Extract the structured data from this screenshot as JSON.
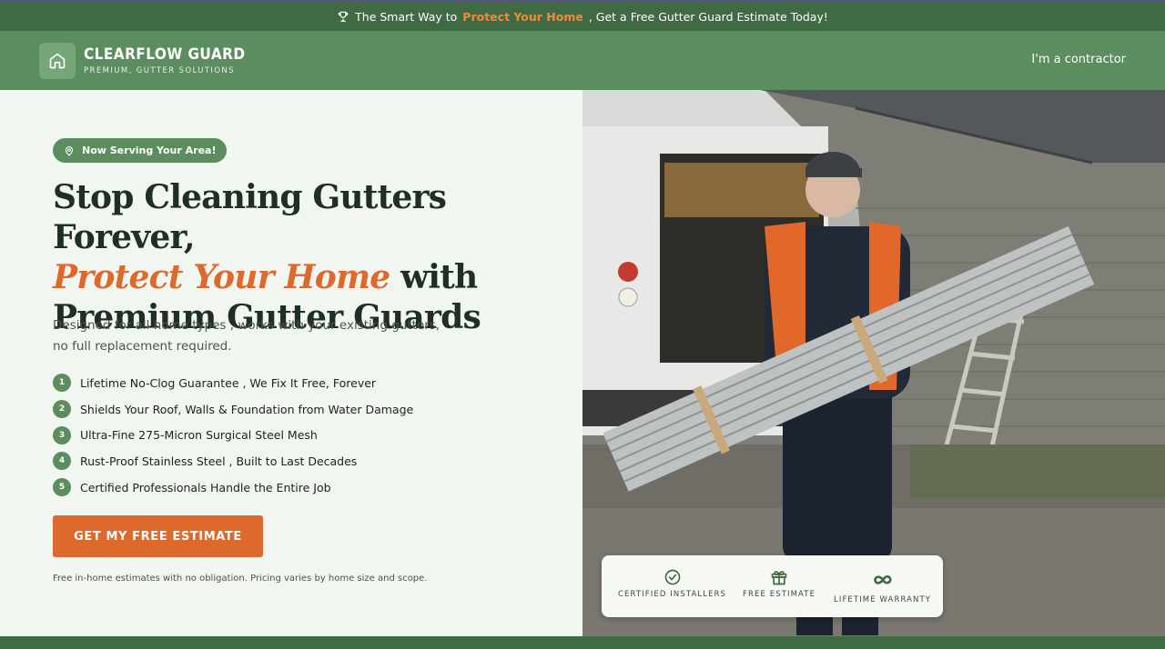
{
  "announcement": {
    "prefix": "The Smart Way to",
    "highlight": "Protect Your Home",
    "suffix": ", Get a Free Gutter Guard Estimate Today!"
  },
  "header": {
    "brand_name": "CLEARFLOW GUARD",
    "brand_tagline": "PREMIUM, GUTTER SOLUTIONS",
    "contractor_link": "I'm a contractor"
  },
  "hero": {
    "badge": "Now Serving Your Area!",
    "headline_line1": "Stop Cleaning Gutters Forever,",
    "headline_accent": "Protect Your Home",
    "headline_line2_rest": " with",
    "headline_line3": "Premium Gutter Guards",
    "subheadline": "Designed for all home types , works with your existing gutters, no full replacement required.",
    "features": [
      {
        "num": "1",
        "text": "Lifetime No-Clog Guarantee , We Fix It Free, Forever"
      },
      {
        "num": "2",
        "text": "Shields Your Roof, Walls & Foundation from Water Damage"
      },
      {
        "num": "3",
        "text": "Ultra-Fine 275-Micron Surgical Steel Mesh"
      },
      {
        "num": "4",
        "text": "Rust-Proof Stainless Steel , Built to Last Decades"
      },
      {
        "num": "5",
        "text": "Certified Professionals Handle the Entire Job"
      }
    ],
    "cta_label": "GET MY FREE ESTIMATE",
    "disclaimer": "Free in-home estimates with no obligation. Pricing varies by home size and scope."
  },
  "trust": {
    "certified": "CERTIFIED INSTALLERS",
    "free_estimate": "FREE ESTIMATE",
    "warranty": "LIFETIME WARRANTY"
  },
  "colors": {
    "brand_green": "#5b8d5f",
    "dark_green": "#3f6a43",
    "accent_orange": "#dd6a2c"
  }
}
